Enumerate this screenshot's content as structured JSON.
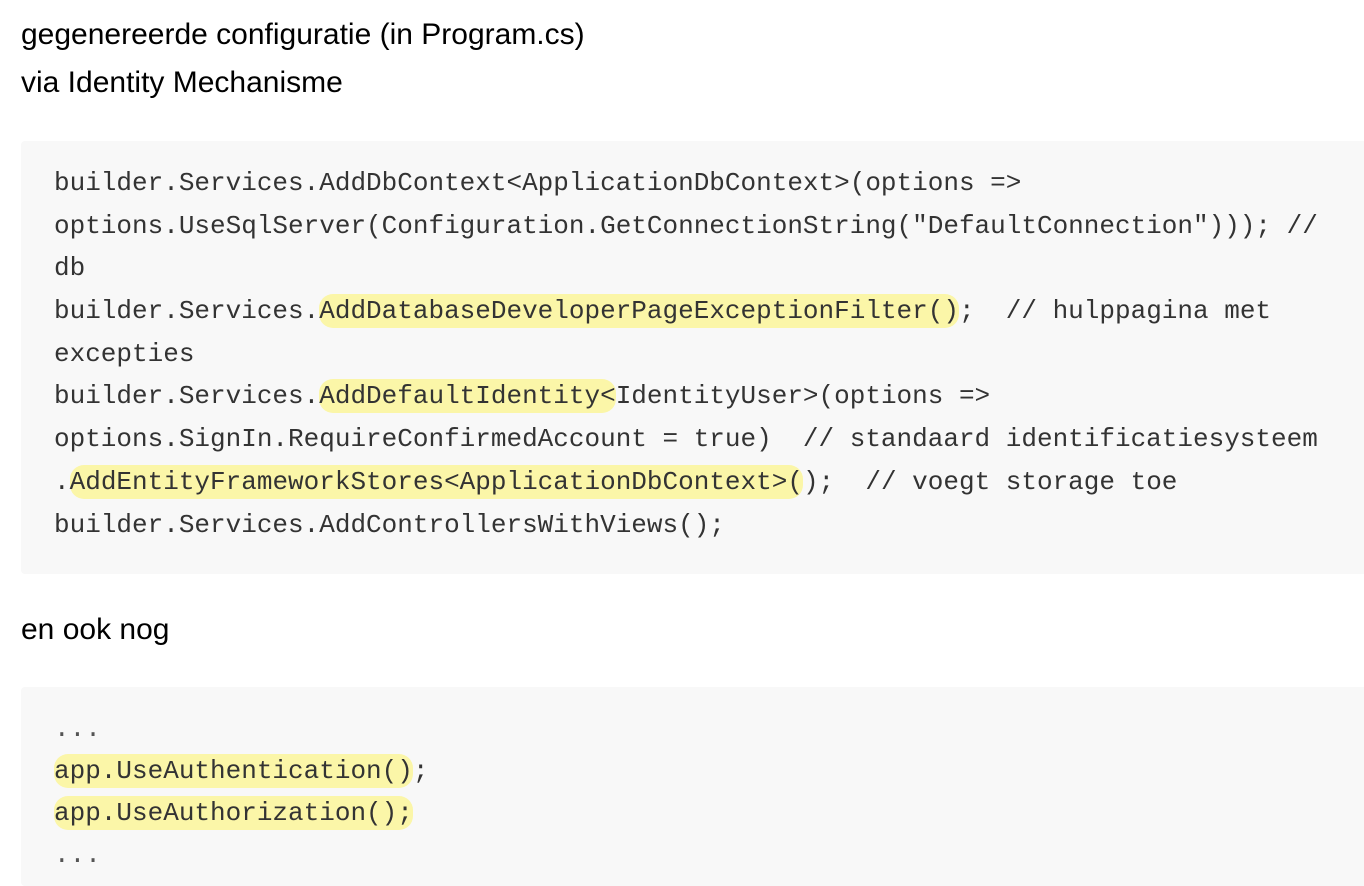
{
  "headings": {
    "line1": "gegenereerde configuratie (in Program.cs)",
    "line2": "via Identity Mechanisme",
    "line3": "en ook nog"
  },
  "code1": {
    "l1": "builder.Services.AddDbContext<ApplicationDbContext>(options =>",
    "l2": "options.UseSqlServer(Configuration.GetConnectionString(\"DefaultConnection\"))); //",
    "l3": "db",
    "l4_pre": "builder.Services.",
    "l4_hl": "AddDatabaseDeveloperPageExceptionFilter()",
    "l4_post": ";  // hulppagina met",
    "l5": "excepties",
    "l6_pre": "builder.Services.",
    "l6_hl": "AddDefaultIdentity<",
    "l6_post": "IdentityUser>(options =>",
    "l7": "options.SignIn.RequireConfirmedAccount = true)  // standaard identificatiesysteem",
    "l8_pre": ".",
    "l8_hl": "AddEntityFrameworkStores<ApplicationDbContext>(",
    "l8_post": ");  // voegt storage toe",
    "l9": "builder.Services.AddControllersWithViews();"
  },
  "code2": {
    "l1": "...",
    "l2_hl": "app.UseAuthentication()",
    "l2_post": ";",
    "l3_hl": "app.UseAuthorization();",
    "l4": "..."
  },
  "colors": {
    "code_background": "#f8f8f8",
    "code_text": "#333333",
    "highlight": "#fbf6a8"
  }
}
